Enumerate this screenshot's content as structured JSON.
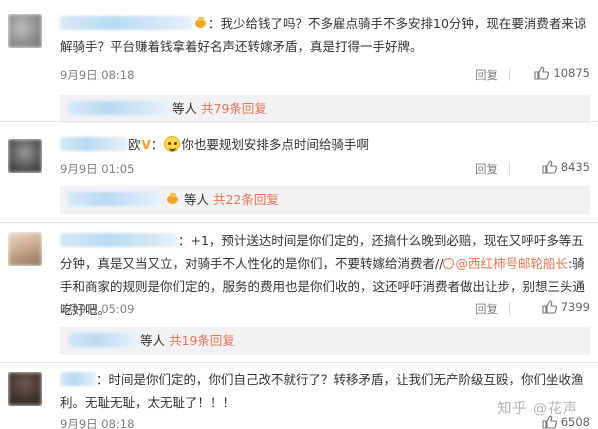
{
  "comments": [
    {
      "text": "：我少给钱了吗？不多雇点骑手不多安排10分钟，现在要消费者来谅解骑手？平台赚着钱拿着好名声还转嫁矛盾，真是打得一手好牌。",
      "date": "9月9日 08:18",
      "reply_label": "回复",
      "likes": "10875",
      "replies": {
        "suffix": "等人",
        "count_label": "共79条回复"
      }
    },
    {
      "name_tail": "欧",
      "text": "你也要规划安排多点时间给骑手啊",
      "date": "9月9日 01:05",
      "reply_label": "回复",
      "likes": "8435",
      "replies": {
        "suffix": "等人",
        "count_label": "共22条回复"
      }
    },
    {
      "text_a": "：+1，预计送达时间是你们定的，还搞什么晚到必赔，现在又呼吁多等五分钟，真是又当又立，对骑手不人性化的是你们，不要转嫁给消费者//",
      "mention": "@西红柿号邮轮船长",
      "text_b": ":骑手和商家的规则是你们定的，服务的费用也是你们收的，这还呼吁消费者做出让步，别想三头通吃好吧。",
      "date": "9月9日 05:09",
      "reply_label": "回复",
      "likes": "7399",
      "replies": {
        "suffix": "等人",
        "count_label": "共19条回复"
      }
    },
    {
      "text": "：时间是你们定的，你们自己改不就行了？转移矛盾，让我们无产阶级互殴，你们坐收渔利。无耻无耻，太无耻了！！！",
      "date": "9月9日 08:18",
      "likes": "6508"
    }
  ],
  "watermark": "知乎 @花声",
  "colors": {
    "accent": "#eb7350",
    "meta": "#808080",
    "subbar_bg": "#f2f2f5"
  },
  "icons": {
    "like": "thumb-up-icon",
    "vip": "vip-crown-icon",
    "emoji": "smile-emoji-icon",
    "mention": "at-icon"
  }
}
